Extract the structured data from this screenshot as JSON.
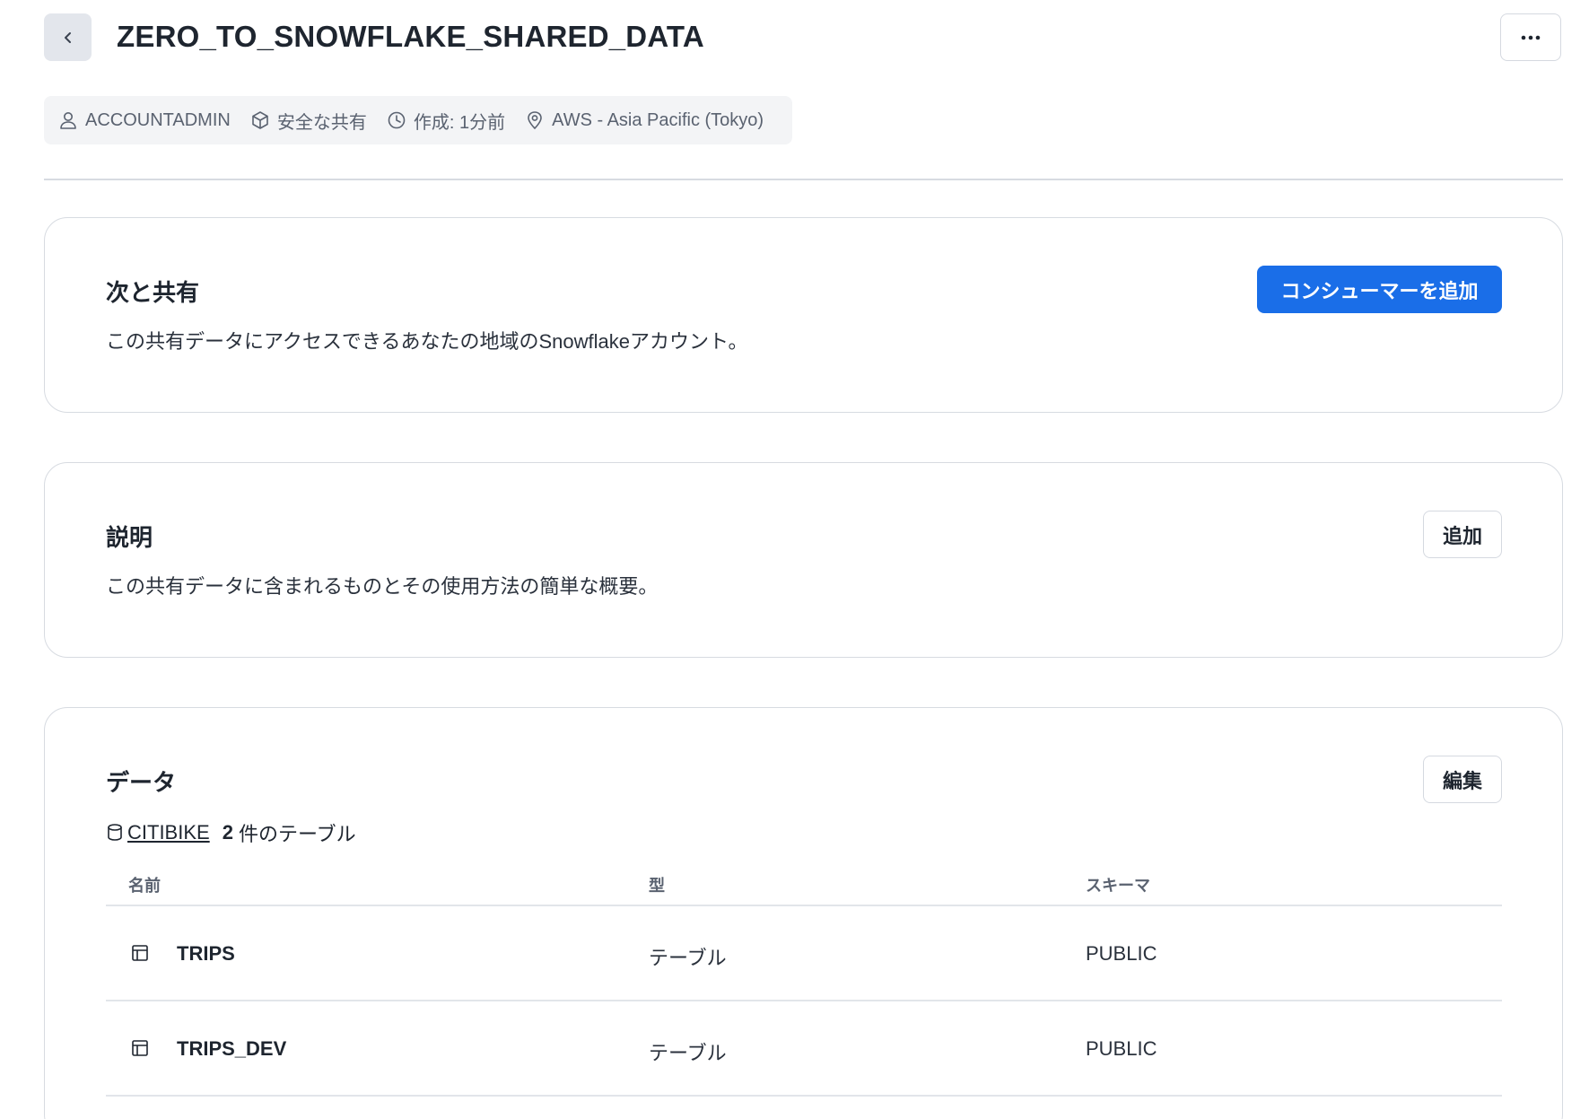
{
  "header": {
    "title": "ZERO_TO_SNOWFLAKE_SHARED_DATA"
  },
  "meta": {
    "role": "ACCOUNTADMIN",
    "share_type": "安全な共有",
    "created": "作成: 1分前",
    "region": "AWS - Asia Pacific (Tokyo)"
  },
  "share_with": {
    "title": "次と共有",
    "description": "この共有データにアクセスできるあなたの地域のSnowflakeアカウント。",
    "button_label": "コンシューマーを追加"
  },
  "description_section": {
    "title": "説明",
    "description": "この共有データに含まれるものとその使用方法の簡単な概要。",
    "button_label": "追加"
  },
  "data_section": {
    "title": "データ",
    "button_label": "編集",
    "database_name": "CITIBIKE",
    "table_count": "2",
    "table_count_suffix": "件のテーブル",
    "columns": {
      "name": "名前",
      "type": "型",
      "schema": "スキーマ"
    },
    "rows": [
      {
        "name": "TRIPS",
        "type": "テーブル",
        "schema": "PUBLIC"
      },
      {
        "name": "TRIPS_DEV",
        "type": "テーブル",
        "schema": "PUBLIC"
      }
    ]
  },
  "colors": {
    "primary": "#1a6ee8",
    "text": "#1e252f",
    "muted": "#5a6270",
    "border": "#d7dbe1"
  }
}
